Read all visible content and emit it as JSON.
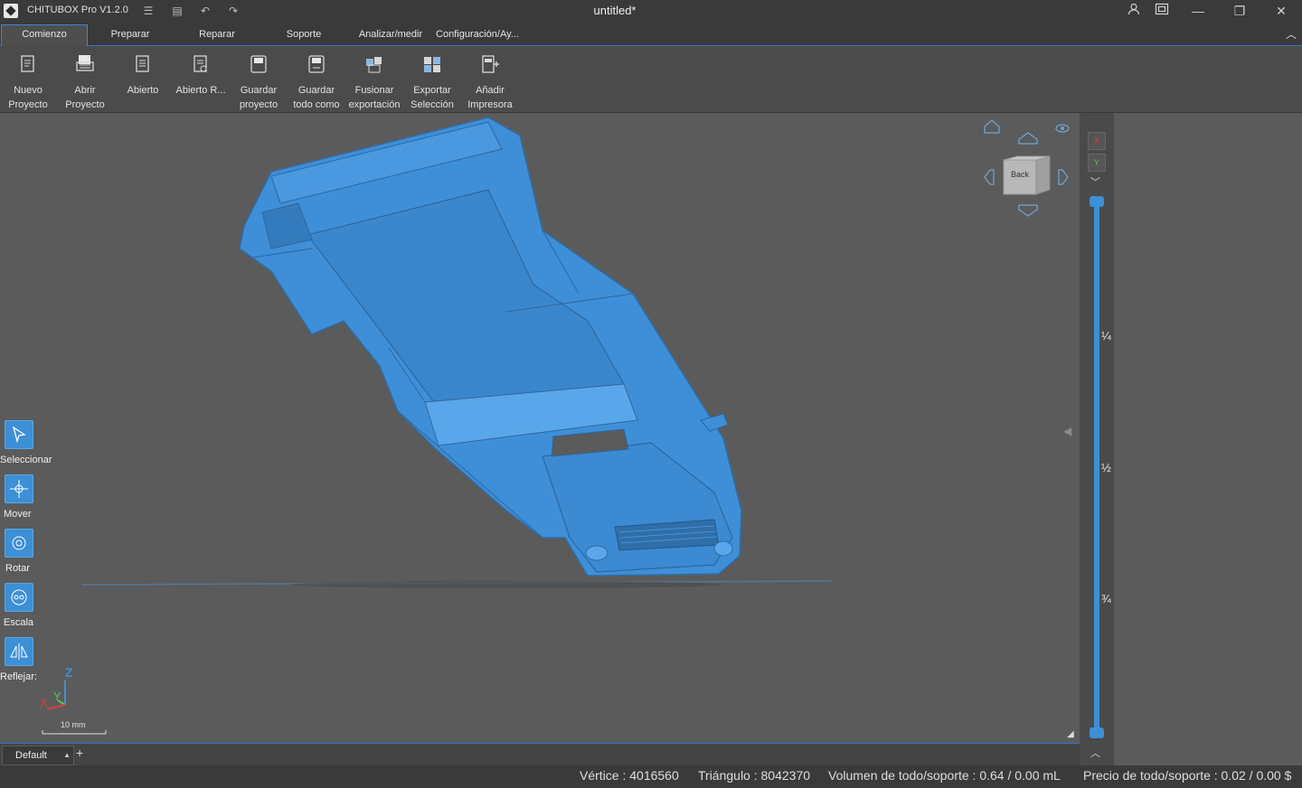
{
  "app": {
    "title": "CHITUBOX Pro V1.2.0",
    "document_title": "untitled*",
    "accent_color": "#3d8fd6",
    "model_color": "#3f8fd8"
  },
  "quick_access": [
    "list-icon",
    "save-icon",
    "undo-icon",
    "redo-icon"
  ],
  "window_controls": [
    "user-icon",
    "screen-icon",
    "minimize-icon",
    "restore-icon",
    "close-icon"
  ],
  "tabs": [
    {
      "label": "Comienzo",
      "active": true
    },
    {
      "label": "Preparar",
      "active": false
    },
    {
      "label": "Reparar",
      "active": false
    },
    {
      "label": "Soporte",
      "active": false
    },
    {
      "label": "Analizar/medir",
      "active": false
    },
    {
      "label": "Configuración/Ay...",
      "active": false
    }
  ],
  "ribbon": [
    {
      "label": "Nuevo\nProyecto",
      "icon": "new-project-icon"
    },
    {
      "label": "Abrir\nProyecto",
      "icon": "open-project-icon"
    },
    {
      "label": "Abierto",
      "icon": "open-file-icon"
    },
    {
      "label": "Abierto R...",
      "icon": "open-recent-icon"
    },
    {
      "label": "Guardar\nproyecto",
      "icon": "save-project-icon"
    },
    {
      "label": "Guardar\ntodo como",
      "icon": "save-all-icon"
    },
    {
      "label": "Fusionar\nexportación",
      "icon": "merge-export-icon"
    },
    {
      "label": "Exportar\nSelección",
      "icon": "export-selection-icon"
    },
    {
      "label": "Añadir\nImpresora",
      "icon": "add-printer-icon"
    }
  ],
  "tools": [
    {
      "label": "Seleccionar",
      "icon": "select-icon"
    },
    {
      "label": "Mover",
      "icon": "move-icon"
    },
    {
      "label": "Rotar",
      "icon": "rotate-icon"
    },
    {
      "label": "Escala",
      "icon": "scale-icon"
    },
    {
      "label": "Reflejar:",
      "icon": "mirror-icon"
    }
  ],
  "nav_cube": {
    "face_label": "Back"
  },
  "axes": {
    "z": "Z",
    "y": "Y",
    "x": "X",
    "scale_label": "10 mm"
  },
  "slicer": {
    "axis_buttons": [
      "X",
      "Y"
    ],
    "ticks": [
      "¼",
      "½",
      "¾"
    ],
    "top_value": 1.0,
    "bottom_value": 0.0
  },
  "plate": {
    "name": "Default",
    "add_label": "+"
  },
  "status": {
    "vertices": "Vértice : 4016560",
    "triangles": "Triángulo : 8042370",
    "volume": "Volumen de todo/soporte : 0.64 / 0.00 mL",
    "price": "Precio de todo/soporte : 0.02 / 0.00 $"
  }
}
